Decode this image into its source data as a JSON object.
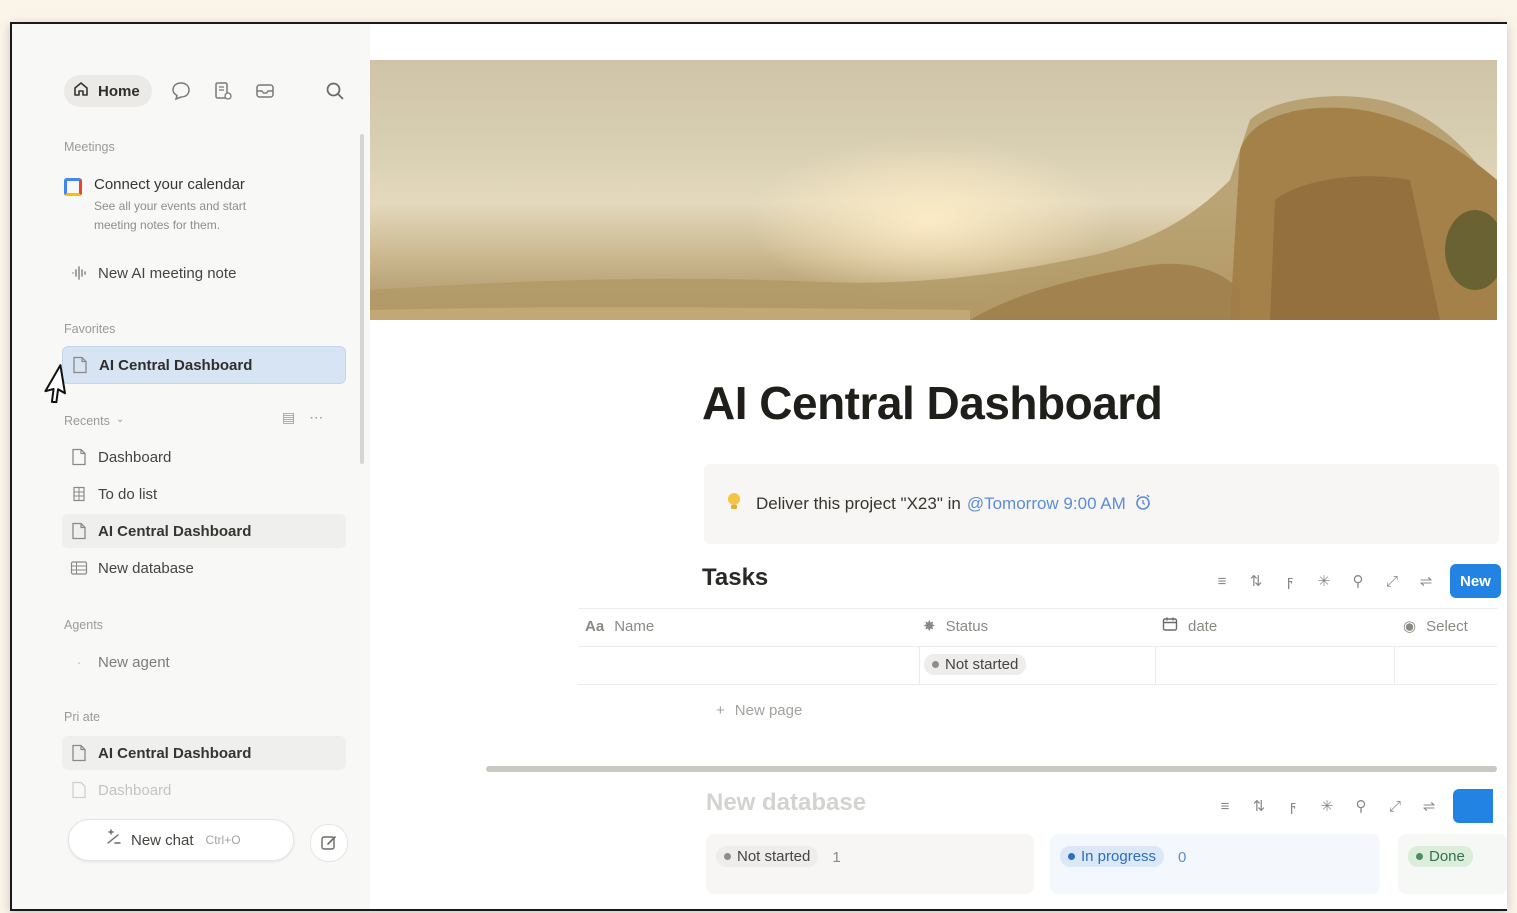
{
  "sidebar": {
    "home_label": "Home",
    "meetings_label": "Meetings",
    "connect_calendar_title": "Connect your calendar",
    "connect_calendar_sub": "See all your events and start meeting notes for them.",
    "new_meeting_note": "New AI meeting note",
    "favorites_label": "Favorites",
    "favorites": [
      {
        "label": "AI Central Dashboard"
      }
    ],
    "recents_label": "Recents",
    "recents": [
      {
        "label": "Dashboard"
      },
      {
        "label": "To do list"
      },
      {
        "label": "AI Central Dashboard"
      },
      {
        "label": "New database"
      }
    ],
    "agents_label": "Agents",
    "new_agent": "New agent",
    "private_label": "Pri ate",
    "private": [
      {
        "label": "AI Central Dashboard"
      },
      {
        "label": "Dashboard"
      }
    ],
    "new_chat": "New chat",
    "new_chat_shortcut": "Ctrl+O"
  },
  "page": {
    "title": "AI Central Dashboard",
    "callout_text": "Deliver this project \"X23\" in",
    "callout_mention": "@Tomorrow 9:00 AM"
  },
  "tasks": {
    "title": "Tasks",
    "new_button": "New",
    "columns": [
      "Name",
      "Status",
      "date",
      "Select"
    ],
    "rows": [
      {
        "name": "",
        "status": "Not started",
        "date": "",
        "select": ""
      }
    ],
    "new_page": "New page"
  },
  "database": {
    "title": "New database",
    "groups": [
      {
        "label": "Not started",
        "count": "1"
      },
      {
        "label": "In progress",
        "count": "0"
      },
      {
        "label": "Done",
        "count": ""
      }
    ]
  }
}
